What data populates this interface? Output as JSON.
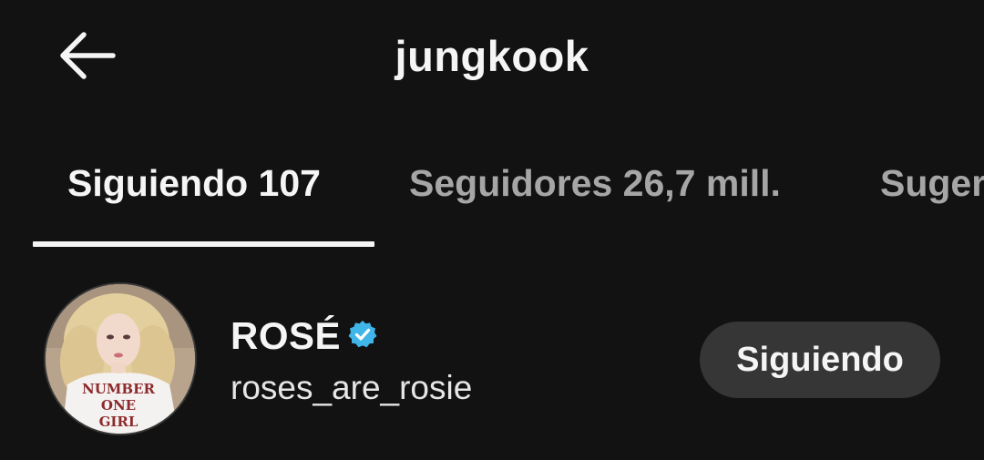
{
  "header": {
    "title": "jungkook",
    "back_icon": "arrow-left-icon"
  },
  "tabs": [
    {
      "label": "Siguiendo 107",
      "active": true
    },
    {
      "label": "Seguidores 26,7 mill.",
      "active": false
    },
    {
      "label": "Suger",
      "active": false
    }
  ],
  "following_list": [
    {
      "name": "ROSÉ",
      "verified": true,
      "verified_icon": "verified-badge-icon",
      "verified_color": "#3fb5e8",
      "handle": "roses_are_rosie",
      "button_label": "Siguiendo",
      "avatar_shirt_text": [
        "NUMBER",
        "ONE",
        "GIRL"
      ]
    }
  ],
  "colors": {
    "background": "#121212",
    "text_primary": "#f5f5f5",
    "text_secondary": "#a6a6a6",
    "button_bg": "#363636"
  }
}
